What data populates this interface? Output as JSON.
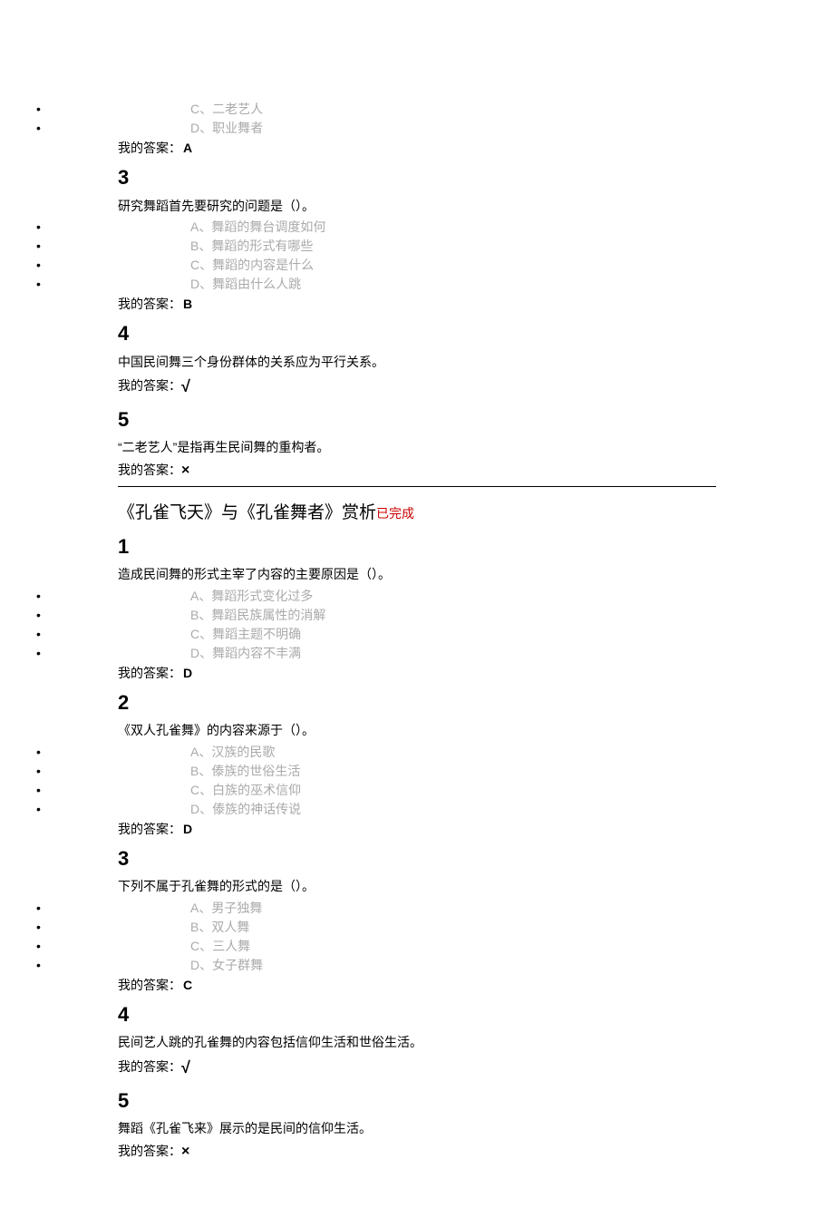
{
  "labels": {
    "my_answer": "我的答案：",
    "completed": "已完成"
  },
  "top_options": [
    "C、二老艺人",
    "D、职业舞者"
  ],
  "top_answer": "A",
  "q3": {
    "num": "3",
    "text": "研究舞蹈首先要研究的问题是（）。",
    "opts": [
      "A、舞蹈的舞台调度如何",
      "B、舞蹈的形式有哪些",
      "C、舞蹈的内容是什么",
      "D、舞蹈由什么人跳"
    ],
    "answer": "B"
  },
  "q4": {
    "num": "4",
    "text": "中国民间舞三个身份群体的关系应为平行关系。",
    "answer": "√"
  },
  "q5": {
    "num": "5",
    "text": "“二老艺人”是指再生民间舞的重构者。",
    "answer": "×"
  },
  "section2": {
    "title": "《孔雀飞天》与《孔雀舞者》赏析"
  },
  "s2q1": {
    "num": "1",
    "text": "造成民间舞的形式主宰了内容的主要原因是（）。",
    "opts": [
      "A、舞蹈形式变化过多",
      "B、舞蹈民族属性的消解",
      "C、舞蹈主题不明确",
      "D、舞蹈内容不丰满"
    ],
    "answer": "D"
  },
  "s2q2": {
    "num": "2",
    "text": "《双人孔雀舞》的内容来源于（）。",
    "opts": [
      "A、汉族的民歌",
      "B、傣族的世俗生活",
      "C、白族的巫术信仰",
      "D、傣族的神话传说"
    ],
    "answer": "D"
  },
  "s2q3": {
    "num": "3",
    "text": "下列不属于孔雀舞的形式的是（）。",
    "opts": [
      "A、男子独舞",
      "B、双人舞",
      "C、三人舞",
      "D、女子群舞"
    ],
    "answer": "C"
  },
  "s2q4": {
    "num": "4",
    "text": "民间艺人跳的孔雀舞的内容包括信仰生活和世俗生活。",
    "answer": "√"
  },
  "s2q5": {
    "num": "5",
    "text": "舞蹈《孔雀飞来》展示的是民间的信仰生活。",
    "answer": "×"
  }
}
